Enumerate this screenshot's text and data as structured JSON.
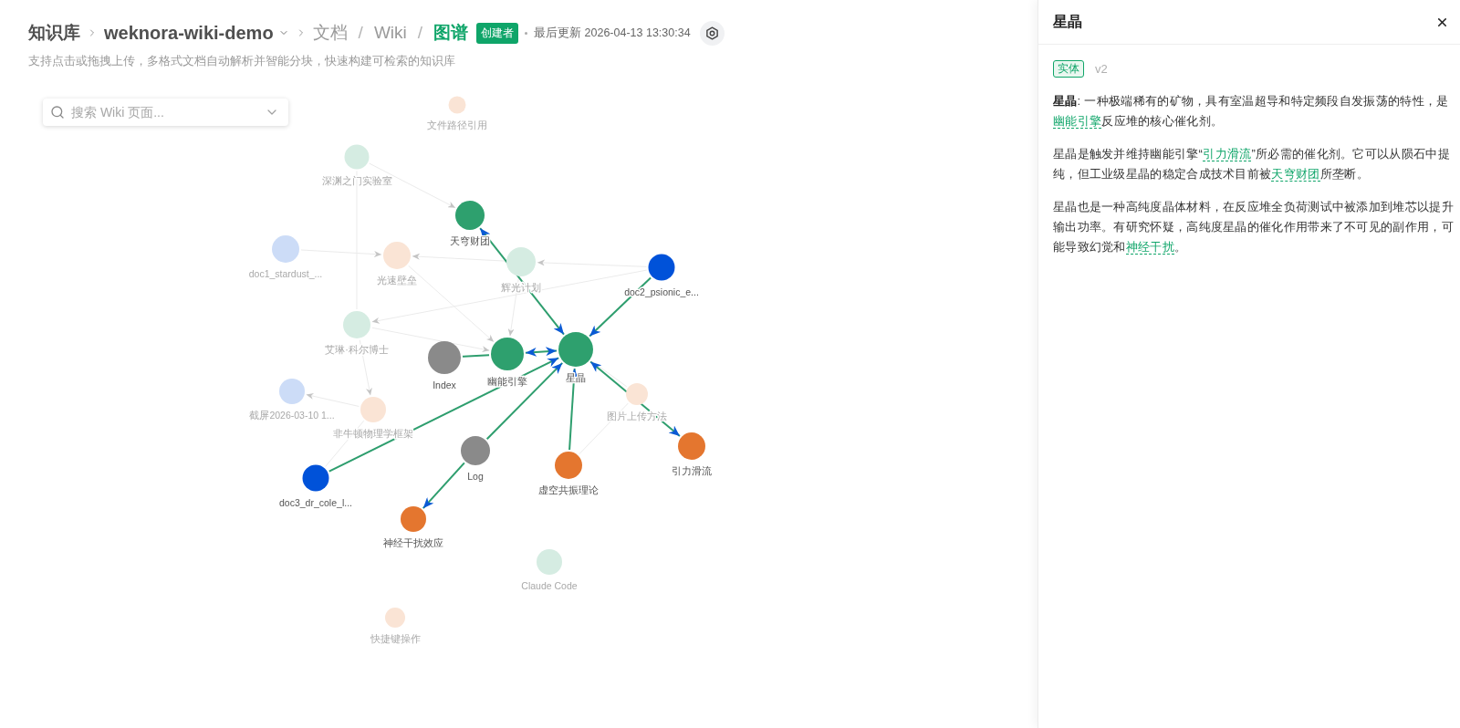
{
  "header": {
    "breadcrumb_root": "知识库",
    "knowledge_base": "weknora-wiki-demo",
    "view_tabs": [
      {
        "label": "文档",
        "selected": false
      },
      {
        "label": "Wiki",
        "selected": false
      },
      {
        "label": "图谱",
        "selected": true
      }
    ],
    "tab_separators": [
      "/",
      "/"
    ],
    "role_badge": "创建者",
    "last_updated": "最后更新 2026-04-13 13:30:34",
    "subtitle": "支持点击或拖拽上传，多格式文档自动解析并智能分块，快速构建可检索的知识库"
  },
  "search": {
    "placeholder": "搜索 Wiki 页面..."
  },
  "graph": {
    "nodes": [
      {
        "label": "文件路径引用",
        "kind": "concept",
        "dimmed": true
      },
      {
        "label": "深渊之门实验室",
        "kind": "entity",
        "dimmed": true
      },
      {
        "label": "天穹财团",
        "kind": "entity",
        "dimmed": false
      },
      {
        "label": "doc1_stardust_...",
        "kind": "document",
        "dimmed": true
      },
      {
        "label": "光速壁垒",
        "kind": "concept",
        "dimmed": true
      },
      {
        "label": "辉光计划",
        "kind": "entity",
        "dimmed": true
      },
      {
        "label": "doc2_psionic_e...",
        "kind": "document",
        "dimmed": false
      },
      {
        "label": "艾琳·科尔博士",
        "kind": "entity",
        "dimmed": true
      },
      {
        "label": "Index",
        "kind": "page",
        "dimmed": false
      },
      {
        "label": "幽能引擎",
        "kind": "entity",
        "dimmed": false
      },
      {
        "label": "星晶",
        "kind": "entity",
        "dimmed": false
      },
      {
        "label": "截屏2026-03-10 1...",
        "kind": "document",
        "dimmed": true
      },
      {
        "label": "非牛顿物理学框架",
        "kind": "concept",
        "dimmed": true
      },
      {
        "label": "图片上传方法",
        "kind": "concept",
        "dimmed": true
      },
      {
        "label": "引力滑流",
        "kind": "concept",
        "dimmed": false
      },
      {
        "label": "Log",
        "kind": "page",
        "dimmed": false
      },
      {
        "label": "虚空共振理论",
        "kind": "concept",
        "dimmed": false
      },
      {
        "label": "doc3_dr_cole_l...",
        "kind": "document",
        "dimmed": false
      },
      {
        "label": "神经干扰效应",
        "kind": "concept",
        "dimmed": false
      },
      {
        "label": "Claude Code",
        "kind": "entity",
        "dimmed": true
      },
      {
        "label": "快捷键操作",
        "kind": "concept",
        "dimmed": true
      }
    ]
  },
  "panel": {
    "title": "星晶",
    "tag": "实体",
    "version": "v2",
    "paragraphs": [
      [
        {
          "kind": "text",
          "text": "**星晶**: 一种极端稀有的矿物，具有室温超导和特定频段自发振荡的特性，是"
        },
        {
          "kind": "link",
          "text": "幽能引擎"
        },
        {
          "kind": "text",
          "text": "反应堆的核心催化剂。"
        }
      ],
      [
        {
          "kind": "text",
          "text": "星晶是触发并维持幽能引擎“"
        },
        {
          "kind": "link",
          "text": "引力滑流"
        },
        {
          "kind": "text",
          "text": "”所必需的催化剂。它可以从陨石中提纯，但工业级星晶的稳定合成技术目前被"
        },
        {
          "kind": "link",
          "text": "天穹财团"
        },
        {
          "kind": "text",
          "text": "所垄断。"
        }
      ],
      [
        {
          "kind": "text",
          "text": "星晶也是一种高纯度晶体材料，在反应堆全负荷测试中被添加到堆芯以提升输出功率。有研究怀疑，高纯度星晶的催化作用带来了不可见的副作用，可能导致幻觉和"
        },
        {
          "kind": "link",
          "text": "神经干扰"
        },
        {
          "kind": "text",
          "text": "。"
        }
      ]
    ]
  }
}
